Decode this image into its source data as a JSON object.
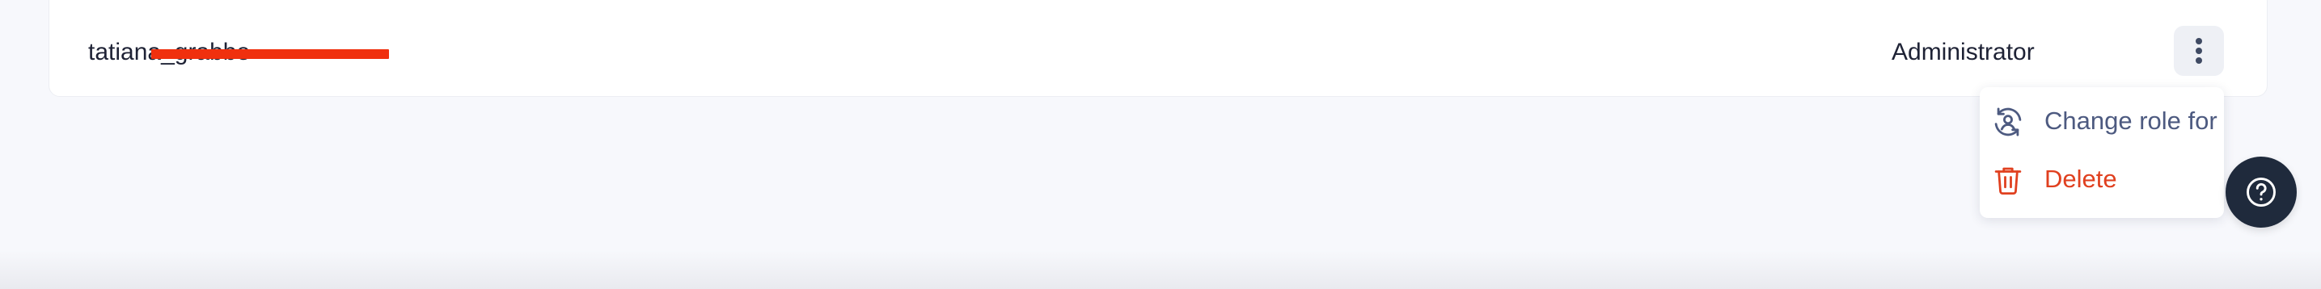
{
  "user_row": {
    "username": "tatiana_grabbe",
    "role": "Administrator",
    "actions_button_icon": "kebab-vertical-icon"
  },
  "actions_menu": {
    "items": [
      {
        "label": "Change role for",
        "icon": "change-role-icon",
        "color": "#4d5a80"
      },
      {
        "label": "Delete",
        "icon": "trash-icon",
        "color": "#e0401f"
      }
    ]
  },
  "help": {
    "icon": "question-circle-icon"
  },
  "colors": {
    "background": "#f7f8fc",
    "danger": "#e0401f",
    "help_button": "#1f2a3c",
    "redaction": "#f0300e"
  }
}
